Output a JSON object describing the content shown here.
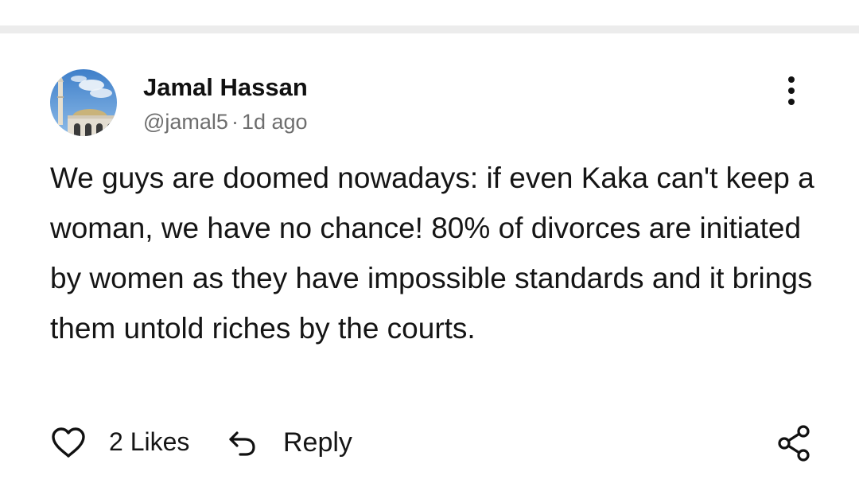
{
  "comment": {
    "author": {
      "name": "Jamal Hassan",
      "handle": "@jamal5",
      "avatar": "mosque-photo-avatar"
    },
    "meta_separator": "·",
    "time_ago": "1d ago",
    "text": "We guys are doomed nowadays: if even Kaka can't keep a woman, we have no chance! 80% of divorces are initiated by women as they have impossible standards and it brings them untold riches by the courts.",
    "actions": {
      "likes_label": "2 Likes",
      "reply_label": "Reply"
    },
    "icons": {
      "more": "more-vertical-icon",
      "like": "heart-outline-icon",
      "reply": "reply-arrow-icon",
      "share": "share-icon"
    }
  },
  "colors": {
    "text_primary": "#111111",
    "text_secondary": "#6e6e6e",
    "divider": "#ececec",
    "background": "#ffffff"
  }
}
